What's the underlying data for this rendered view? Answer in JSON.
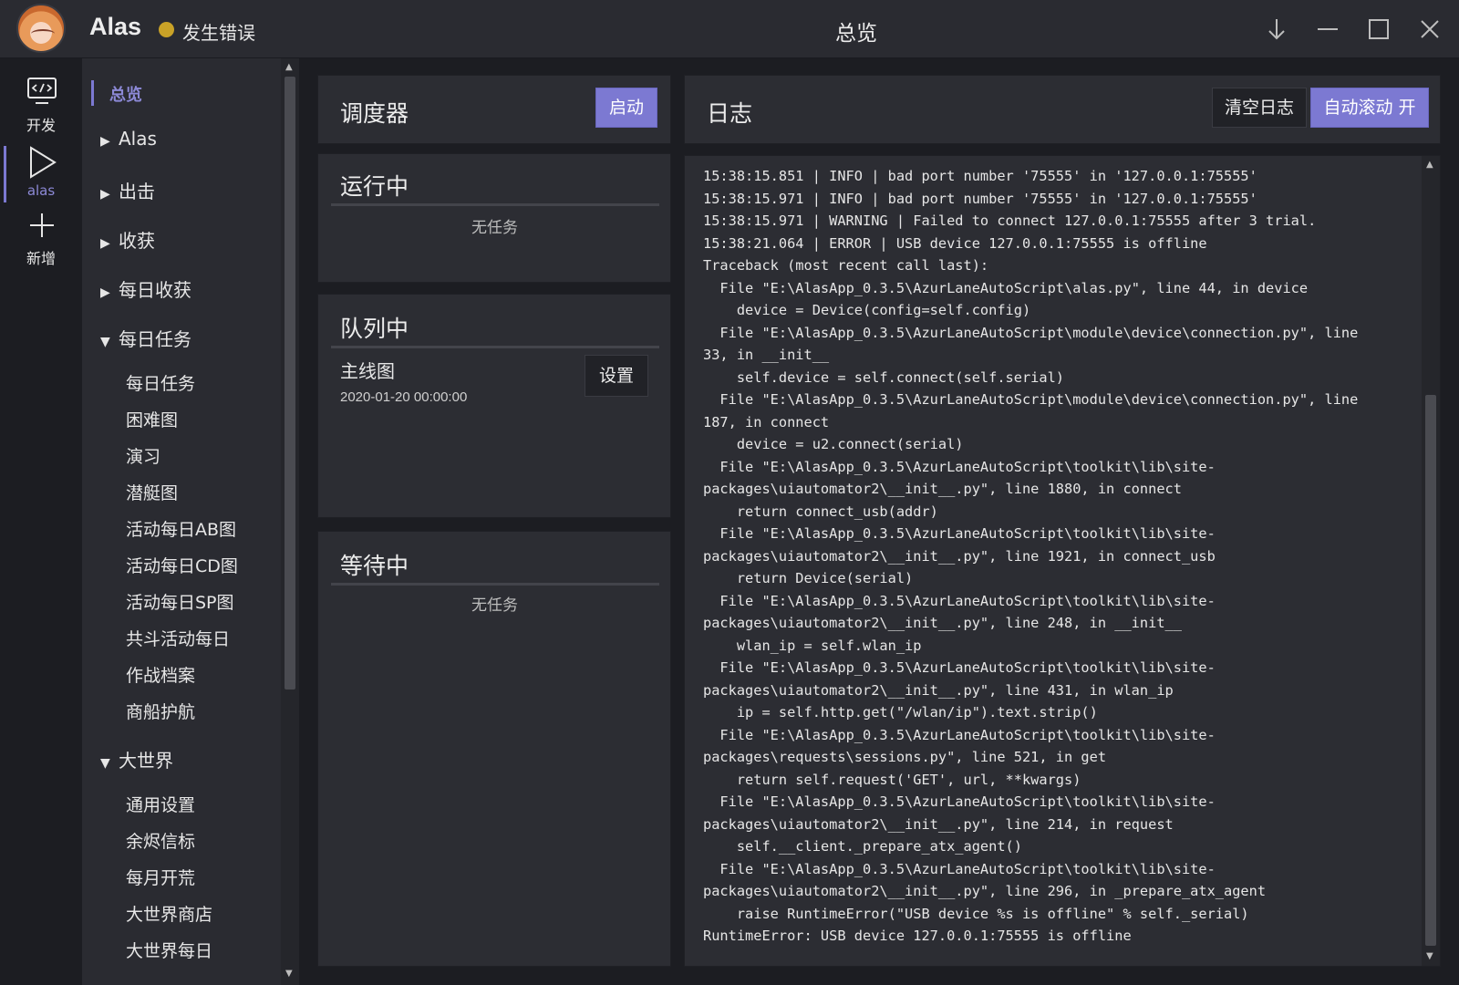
{
  "titlebar": {
    "app_name": "Alas",
    "status": "发生错误",
    "status_color": "#c9a227",
    "page_title": "总览",
    "controls": [
      "download-icon",
      "minimize-icon",
      "maximize-icon",
      "close-icon"
    ]
  },
  "iconbar": {
    "items": [
      {
        "label": "开发",
        "icon": "code-monitor-icon"
      },
      {
        "label": "alas",
        "icon": "play-icon",
        "active": true
      },
      {
        "label": "新增",
        "icon": "plus-icon"
      }
    ]
  },
  "menu": {
    "items": [
      {
        "label": "总览",
        "active": true
      },
      {
        "label": "Alas",
        "expanded": false
      },
      {
        "label": "出击",
        "expanded": false
      },
      {
        "label": "收获",
        "expanded": false
      },
      {
        "label": "每日收获",
        "expanded": false
      },
      {
        "label": "每日任务",
        "expanded": true
      },
      {
        "label": "大世界",
        "expanded": true
      }
    ],
    "daily_subitems": [
      "每日任务",
      "困难图",
      "演习",
      "潜艇图",
      "活动每日AB图",
      "活动每日CD图",
      "活动每日SP图",
      "共斗活动每日",
      "作战档案",
      "商船护航"
    ],
    "world_subitems": [
      "通用设置",
      "余烬信标",
      "每月开荒",
      "大世界商店",
      "大世界每日"
    ]
  },
  "scheduler": {
    "title": "调度器",
    "start_button": "启动"
  },
  "running": {
    "title": "运行中",
    "empty": "无任务"
  },
  "queue": {
    "title": "队列中",
    "task_name": "主线图",
    "task_time": "2020-01-20 00:00:00",
    "settings_button": "设置"
  },
  "waiting": {
    "title": "等待中",
    "empty": "无任务"
  },
  "log": {
    "title": "日志",
    "clear_button": "清空日志",
    "autoscroll_button": "自动滚动 开",
    "lines": [
      "15:38:15.851 | INFO | bad port number '75555' in '127.0.0.1:75555'",
      "15:38:15.971 | INFO | bad port number '75555' in '127.0.0.1:75555'",
      "15:38:15.971 | WARNING | Failed to connect 127.0.0.1:75555 after 3 trial.",
      "15:38:21.064 | ERROR | USB device 127.0.0.1:75555 is offline",
      "Traceback (most recent call last):",
      "  File \"E:\\AlasApp_0.3.5\\AzurLaneAutoScript\\alas.py\", line 44, in device",
      "    device = Device(config=self.config)",
      "  File \"E:\\AlasApp_0.3.5\\AzurLaneAutoScript\\module\\device\\connection.py\", line",
      "33, in __init__",
      "    self.device = self.connect(self.serial)",
      "  File \"E:\\AlasApp_0.3.5\\AzurLaneAutoScript\\module\\device\\connection.py\", line",
      "187, in connect",
      "    device = u2.connect(serial)",
      "  File \"E:\\AlasApp_0.3.5\\AzurLaneAutoScript\\toolkit\\lib\\site-",
      "packages\\uiautomator2\\__init__.py\", line 1880, in connect",
      "    return connect_usb(addr)",
      "  File \"E:\\AlasApp_0.3.5\\AzurLaneAutoScript\\toolkit\\lib\\site-",
      "packages\\uiautomator2\\__init__.py\", line 1921, in connect_usb",
      "    return Device(serial)",
      "  File \"E:\\AlasApp_0.3.5\\AzurLaneAutoScript\\toolkit\\lib\\site-",
      "packages\\uiautomator2\\__init__.py\", line 248, in __init__",
      "    wlan_ip = self.wlan_ip",
      "  File \"E:\\AlasApp_0.3.5\\AzurLaneAutoScript\\toolkit\\lib\\site-",
      "packages\\uiautomator2\\__init__.py\", line 431, in wlan_ip",
      "    ip = self.http.get(\"/wlan/ip\").text.strip()",
      "  File \"E:\\AlasApp_0.3.5\\AzurLaneAutoScript\\toolkit\\lib\\site-",
      "packages\\requests\\sessions.py\", line 521, in get",
      "    return self.request('GET', url, **kwargs)",
      "  File \"E:\\AlasApp_0.3.5\\AzurLaneAutoScript\\toolkit\\lib\\site-",
      "packages\\uiautomator2\\__init__.py\", line 214, in request",
      "    self.__client._prepare_atx_agent()",
      "  File \"E:\\AlasApp_0.3.5\\AzurLaneAutoScript\\toolkit\\lib\\site-",
      "packages\\uiautomator2\\__init__.py\", line 296, in _prepare_atx_agent",
      "    raise RuntimeError(\"USB device %s is offline\" % self._serial)",
      "RuntimeError: USB device 127.0.0.1:75555 is offline"
    ]
  },
  "colors": {
    "accent": "#7c79d2",
    "background": "#1c1d22",
    "panel": "#2c2d33"
  }
}
